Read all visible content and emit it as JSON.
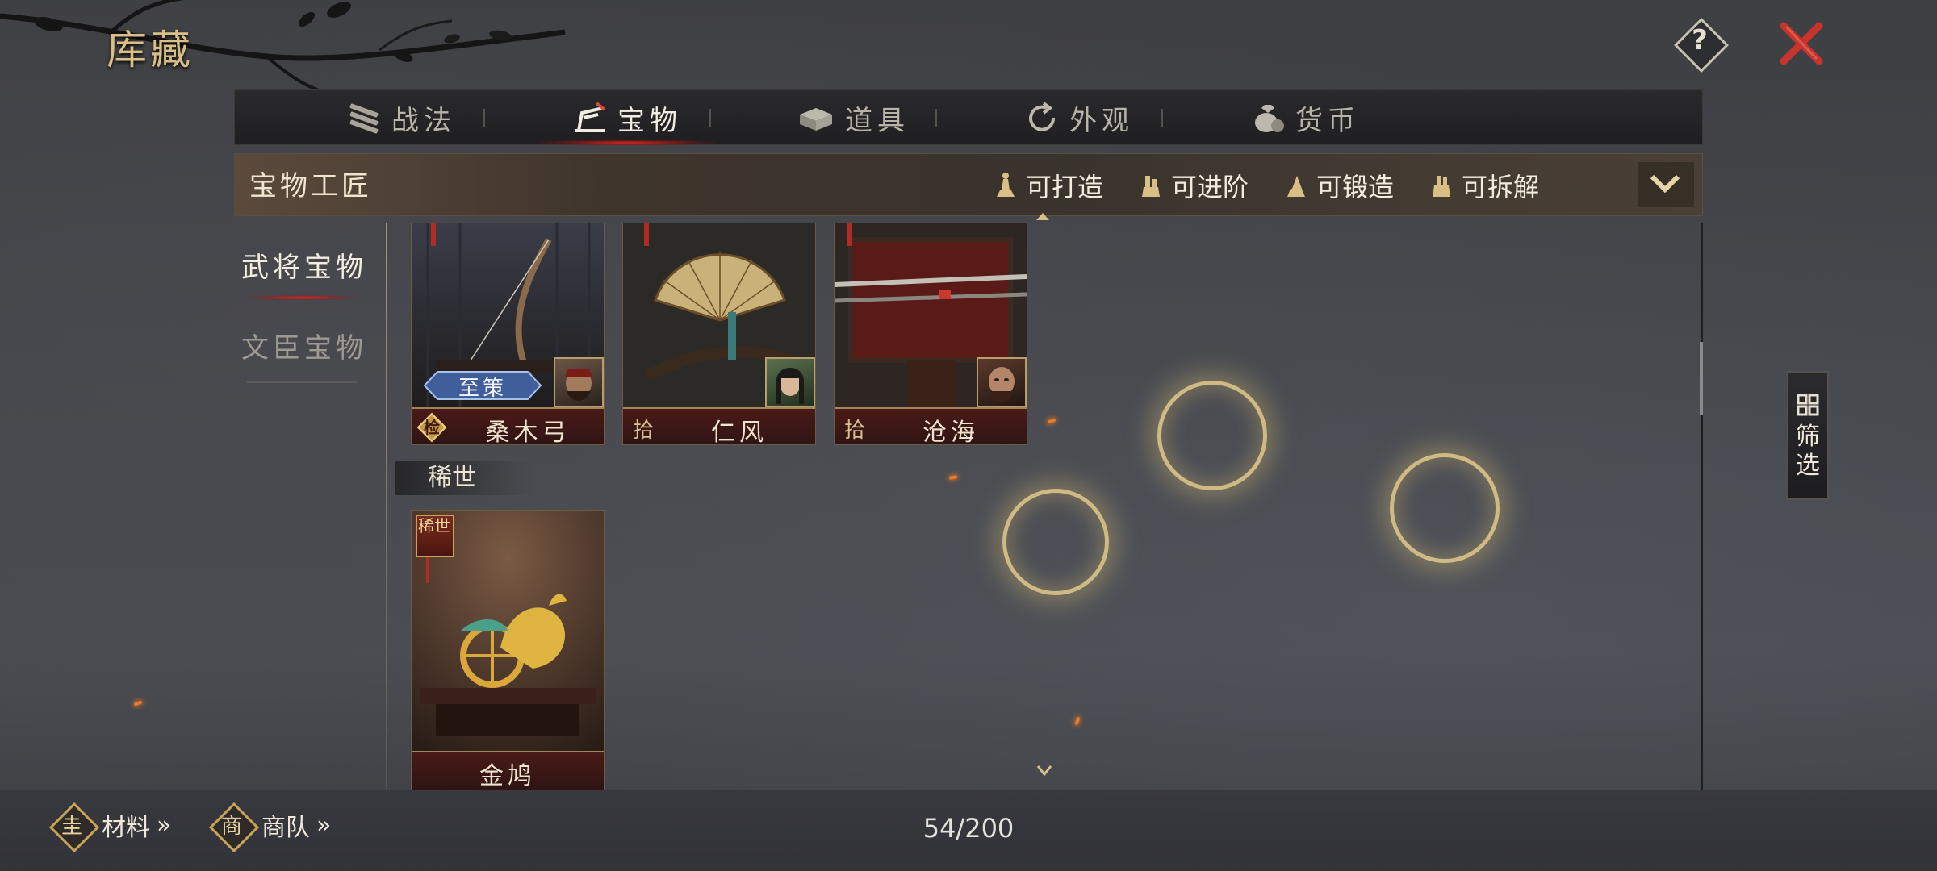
{
  "header": {
    "title": "库藏",
    "help_label": "?"
  },
  "tabs": [
    {
      "label": "战法",
      "icon": "scroll-icon",
      "active": false
    },
    {
      "label": "宝物",
      "icon": "treasure-icon",
      "active": true
    },
    {
      "label": "道具",
      "icon": "box-icon",
      "active": false
    },
    {
      "label": "外观",
      "icon": "cycle-icon",
      "active": false
    },
    {
      "label": "货币",
      "icon": "money-bag-icon",
      "active": false
    }
  ],
  "craftsman": {
    "title": "宝物工匠",
    "filters": [
      {
        "label": "可打造",
        "icon": "anvil-icon"
      },
      {
        "label": "可进阶",
        "icon": "hammer-icon"
      },
      {
        "label": "可锻造",
        "icon": "forge-icon"
      },
      {
        "label": "可拆解",
        "icon": "dismantle-icon"
      }
    ]
  },
  "side_nav": [
    {
      "label": "武将宝物",
      "active": true
    },
    {
      "label": "文臣宝物",
      "active": false
    }
  ],
  "cards": [
    {
      "name": "桑木弓",
      "grade": "",
      "badge": "至策",
      "seal": "检"
    },
    {
      "name": "仁风",
      "grade": "拾"
    },
    {
      "name": "沧海",
      "grade": "拾"
    }
  ],
  "rare_section": {
    "label": "稀世",
    "cards": [
      {
        "name": "金鸠",
        "tag": "稀世"
      }
    ]
  },
  "filter_button": {
    "line1": "筛",
    "line2": "选"
  },
  "bottom": {
    "links": [
      {
        "label": "材料",
        "icon": "material-icon",
        "icon_char": "圭"
      },
      {
        "label": "商队",
        "icon": "caravan-icon",
        "icon_char": "商"
      }
    ],
    "count": "54/200"
  },
  "colors": {
    "accent_gold": "#d9bf86",
    "active_red": "#dc281e",
    "close_red": "#c8332b"
  }
}
